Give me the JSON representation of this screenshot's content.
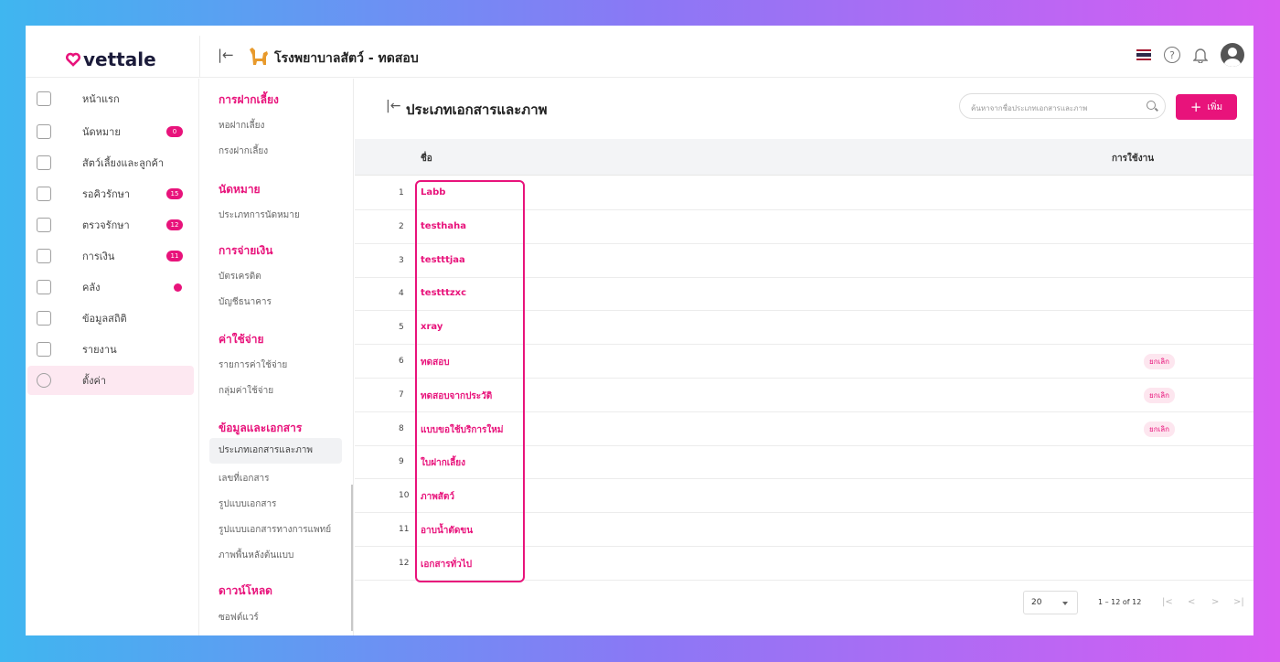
{
  "app": {
    "logo": "vettale",
    "clinic_name": "โรงพยาบาลสัตว์ - ทดสอบ"
  },
  "topbar": {
    "help_icon": "question-circle-icon",
    "bell_icon": "bell-icon",
    "flag": "thai-flag-icon"
  },
  "sidebar": {
    "items": [
      {
        "label": "หน้าแรก",
        "icon": "home-icon"
      },
      {
        "label": "นัดหมาย",
        "icon": "calendar-icon",
        "badge": "0"
      },
      {
        "label": "สัตว์เลี้ยงและลูกค้า",
        "icon": "paw-icon"
      },
      {
        "label": "รอคิวรักษา",
        "icon": "queue-icon",
        "badge": "15"
      },
      {
        "label": "ตรวจรักษา",
        "icon": "stethoscope-icon",
        "badge": "12"
      },
      {
        "label": "การเงิน",
        "icon": "money-icon",
        "badge": "11"
      },
      {
        "label": "คลัง",
        "icon": "box-icon",
        "dot": true
      },
      {
        "label": "ข้อมูลสถิติ",
        "icon": "grid-icon"
      },
      {
        "label": "รายงาน",
        "icon": "report-icon"
      },
      {
        "label": "ตั้งค่า",
        "icon": "gear-icon",
        "active": true
      }
    ]
  },
  "submenu": {
    "sections": [
      {
        "title": "การฝากเลี้ยง",
        "items": [
          "หอฝากเลี้ยง",
          "กรงฝากเลี้ยง"
        ]
      },
      {
        "title": "นัดหมาย",
        "items": [
          "ประเภทการนัดหมาย"
        ]
      },
      {
        "title": "การจ่ายเงิน",
        "items": [
          "บัตรเครดิต",
          "บัญชีธนาคาร"
        ]
      },
      {
        "title": "ค่าใช้จ่าย",
        "items": [
          "รายการค่าใช้จ่าย",
          "กลุ่มค่าใช้จ่าย"
        ]
      },
      {
        "title": "ข้อมูลและเอกสาร",
        "items": [
          "ประเภทเอกสารและภาพ",
          "เลขที่เอกสาร",
          "รูปแบบเอกสาร",
          "รูปแบบเอกสารทางการแพทย์",
          "ภาพพื้นหลังต้นแบบ"
        ]
      },
      {
        "title": "ดาวน์โหลด",
        "items": [
          "ซอฟต์แวร์"
        ]
      }
    ]
  },
  "main": {
    "title": "ประเภทเอกสารและภาพ",
    "search_placeholder": "ค้นหาจากชื่อประเภทเอกสารและภาพ",
    "add_label": "เพิ่ม",
    "columns": {
      "name": "ชื่อ",
      "usage": "การใช้งาน"
    },
    "rows": [
      {
        "no": "1",
        "name": "Labb",
        "status": ""
      },
      {
        "no": "2",
        "name": "testhaha",
        "status": ""
      },
      {
        "no": "3",
        "name": "testttjaa",
        "status": ""
      },
      {
        "no": "4",
        "name": "testttzxc",
        "status": ""
      },
      {
        "no": "5",
        "name": "xray",
        "status": ""
      },
      {
        "no": "6",
        "name": "ทดสอบ",
        "status": "ยกเลิก"
      },
      {
        "no": "7",
        "name": "ทดสอบจากประวัติ",
        "status": "ยกเลิก"
      },
      {
        "no": "8",
        "name": "แบบขอใช้บริการใหม่",
        "status": "ยกเลิก"
      },
      {
        "no": "9",
        "name": "ใบฝากเลี้ยง",
        "status": ""
      },
      {
        "no": "10",
        "name": "ภาพสัตว์",
        "status": ""
      },
      {
        "no": "11",
        "name": "อาบน้ำตัดขน",
        "status": ""
      },
      {
        "no": "12",
        "name": "เอกสารทั่วไป",
        "status": ""
      }
    ],
    "pagination": {
      "page_size": "20",
      "range": "1 – 12 of 12"
    }
  },
  "colors": {
    "accent": "#e8137b"
  }
}
